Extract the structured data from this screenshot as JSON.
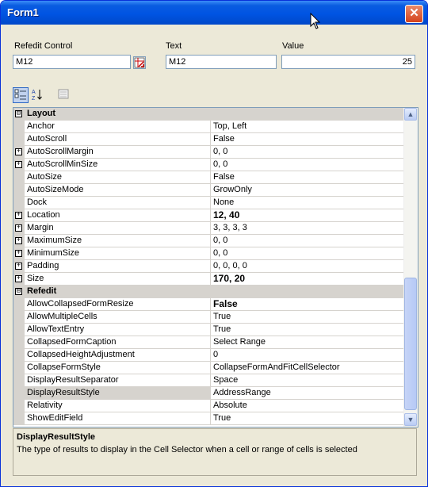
{
  "window": {
    "title": "Form1"
  },
  "labels": {
    "refedit_control": "Refedit Control",
    "text": "Text",
    "value": "Value"
  },
  "fields": {
    "refedit_control": "M12",
    "text": "M12",
    "value": "25"
  },
  "colors": {
    "titlebar": "#0054e3",
    "category_bg": "#d6d3ce",
    "window_bg": "#ece9d8"
  },
  "toolbar": {
    "buttons": [
      "categorized-icon",
      "alphabetical-icon",
      "property-pages-icon"
    ]
  },
  "grid": {
    "categories": [
      {
        "name": "Layout",
        "expanded": true
      },
      {
        "name": "Refedit",
        "expanded": true
      }
    ],
    "rows": [
      {
        "type": "category",
        "name": "Layout",
        "expander": "⊟"
      },
      {
        "type": "prop",
        "name": "Anchor",
        "value": "Top, Left",
        "expander": ""
      },
      {
        "type": "prop",
        "name": "AutoScroll",
        "value": "False",
        "expander": ""
      },
      {
        "type": "prop",
        "name": "AutoScrollMargin",
        "value": "0, 0",
        "expander": "+"
      },
      {
        "type": "prop",
        "name": "AutoScrollMinSize",
        "value": "0, 0",
        "expander": "+"
      },
      {
        "type": "prop",
        "name": "AutoSize",
        "value": "False",
        "expander": ""
      },
      {
        "type": "prop",
        "name": "AutoSizeMode",
        "value": "GrowOnly",
        "expander": ""
      },
      {
        "type": "prop",
        "name": "Dock",
        "value": "None",
        "expander": ""
      },
      {
        "type": "prop",
        "name": "Location",
        "value": "12, 40",
        "expander": "+",
        "bold": true
      },
      {
        "type": "prop",
        "name": "Margin",
        "value": "3, 3, 3, 3",
        "expander": "+"
      },
      {
        "type": "prop",
        "name": "MaximumSize",
        "value": "0, 0",
        "expander": "+"
      },
      {
        "type": "prop",
        "name": "MinimumSize",
        "value": "0, 0",
        "expander": "+"
      },
      {
        "type": "prop",
        "name": "Padding",
        "value": "0, 0, 0, 0",
        "expander": "+"
      },
      {
        "type": "prop",
        "name": "Size",
        "value": "170, 20",
        "expander": "+",
        "bold": true
      },
      {
        "type": "category",
        "name": "Refedit",
        "expander": "⊟"
      },
      {
        "type": "prop",
        "name": "AllowCollapsedFormResize",
        "value": "False",
        "expander": "",
        "bold": true
      },
      {
        "type": "prop",
        "name": "AllowMultipleCells",
        "value": "True",
        "expander": ""
      },
      {
        "type": "prop",
        "name": "AllowTextEntry",
        "value": "True",
        "expander": ""
      },
      {
        "type": "prop",
        "name": "CollapsedFormCaption",
        "value": "Select Range",
        "expander": ""
      },
      {
        "type": "prop",
        "name": "CollapsedHeightAdjustment",
        "value": "0",
        "expander": ""
      },
      {
        "type": "prop",
        "name": "CollapseFormStyle",
        "value": "CollapseFormAndFitCellSelector",
        "expander": ""
      },
      {
        "type": "prop",
        "name": "DisplayResultSeparator",
        "value": "Space",
        "expander": ""
      },
      {
        "type": "prop",
        "name": "DisplayResultStyle",
        "value": "AddressRange",
        "expander": "",
        "selected": true
      },
      {
        "type": "prop",
        "name": "Relativity",
        "value": "Absolute",
        "expander": ""
      },
      {
        "type": "prop",
        "name": "ShowEditField",
        "value": "True",
        "expander": ""
      }
    ]
  },
  "help": {
    "title": "DisplayResultStyle",
    "text": "The type of results to display in the Cell Selector when a cell or range of cells is selected"
  }
}
